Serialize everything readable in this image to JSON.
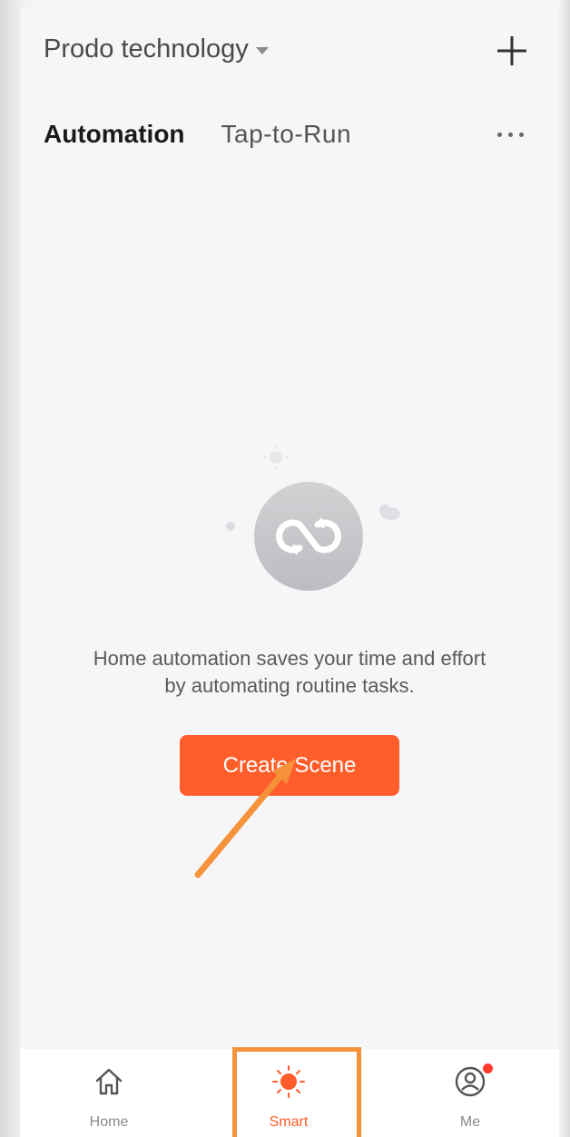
{
  "header": {
    "home_name": "Prodo technology",
    "add_icon": "plus-icon"
  },
  "tabs": [
    {
      "label": "Automation",
      "active": true
    },
    {
      "label": "Tap-to-Run",
      "active": false
    }
  ],
  "more_icon": "more-horizontal-icon",
  "empty_state": {
    "illustration_icon": "sync-loop-icon",
    "message_line1": "Home automation saves your time and effort",
    "message_line2": "by automating routine tasks.",
    "button_label": "Create Scene"
  },
  "annotation": {
    "arrow_color": "#f5923a"
  },
  "bottom_nav": [
    {
      "label": "Home",
      "icon": "home-icon",
      "active": false
    },
    {
      "label": "Smart",
      "icon": "sun-icon",
      "active": true
    },
    {
      "label": "Me",
      "icon": "profile-icon",
      "active": false,
      "badge": true
    }
  ],
  "colors": {
    "accent": "#ff5d2a",
    "highlight": "#f5923a",
    "background": "#f6f6f8"
  }
}
